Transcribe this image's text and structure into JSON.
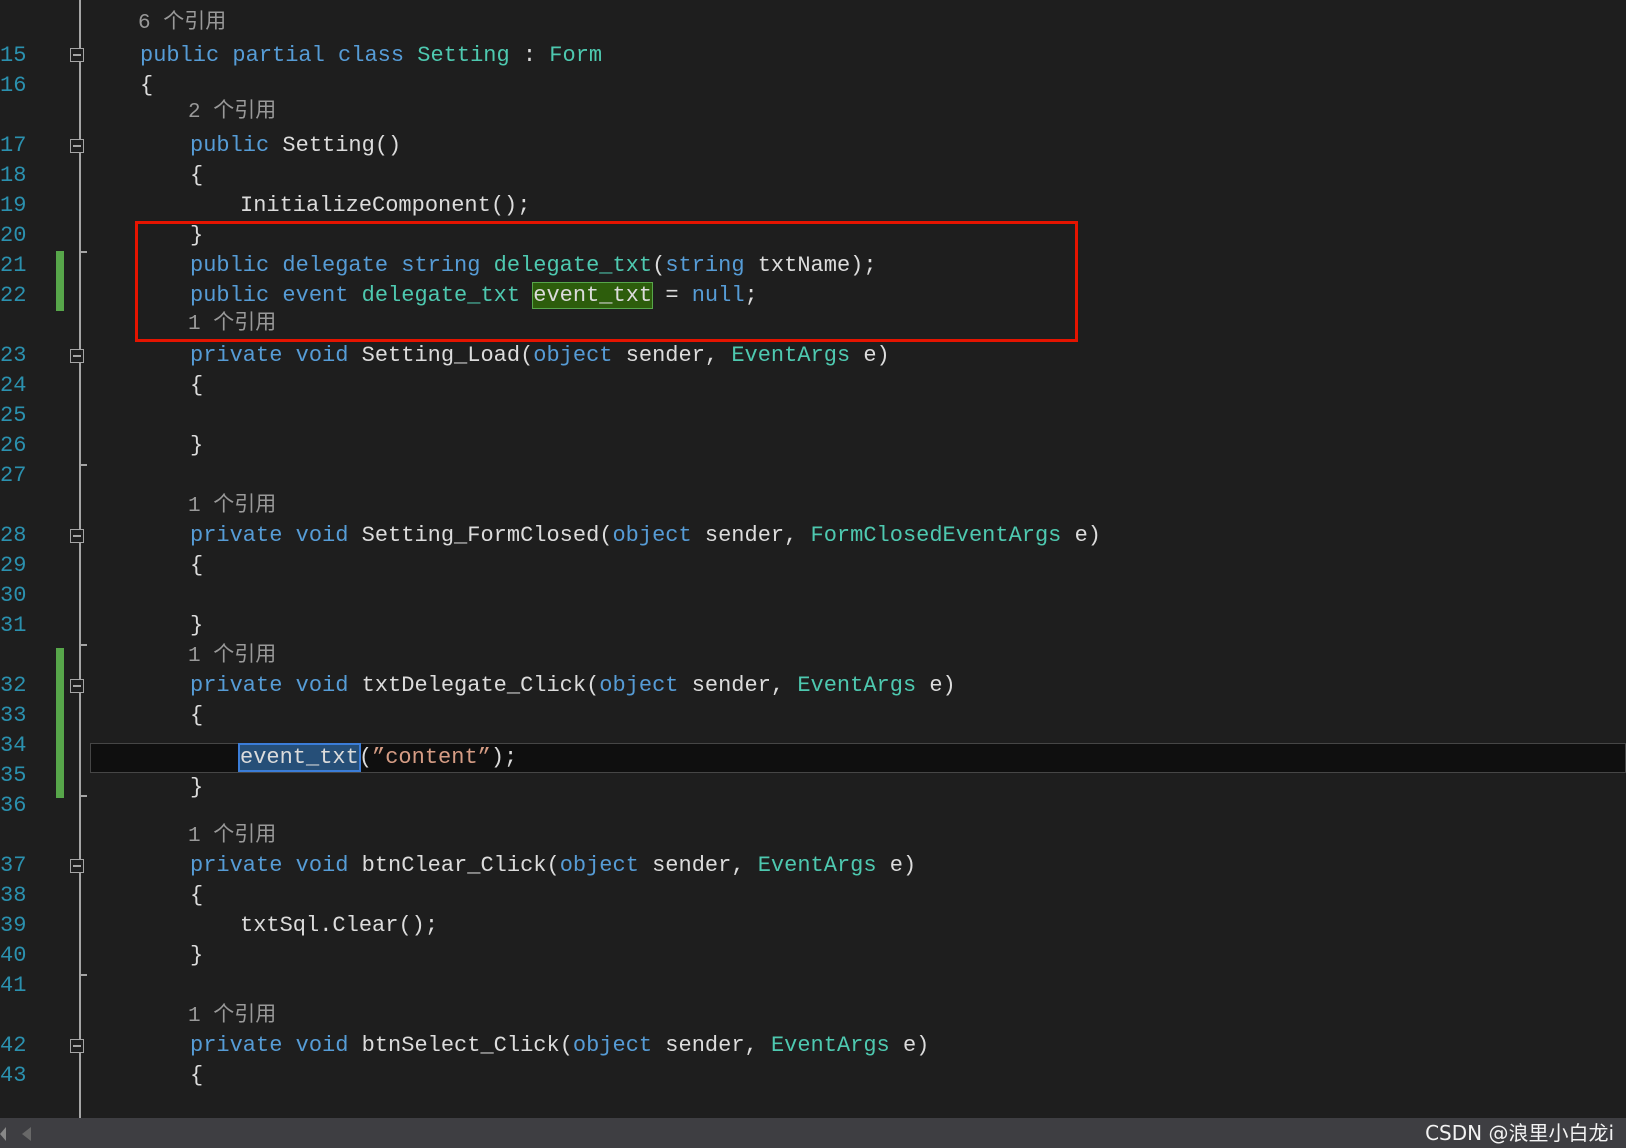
{
  "editor": {
    "ref_labels": {
      "r6": "6 个引用",
      "r2": "2 个引用",
      "r1": "1 个引用"
    },
    "line_numbers": {
      "l15": "15",
      "l16": "16",
      "l17": "17",
      "l18": "18",
      "l19": "19",
      "l20": "20",
      "l21": "21",
      "l22": "22",
      "l23": "23",
      "l24": "24",
      "l25": "25",
      "l26": "26",
      "l27": "27",
      "l28": "28",
      "l29": "29",
      "l30": "30",
      "l31": "31",
      "l32": "32",
      "l33": "33",
      "l34": "34",
      "l35": "35",
      "l36": "36",
      "l37": "37",
      "l38": "38",
      "l39": "39",
      "l40": "40",
      "l41": "41",
      "l42": "42",
      "l43": "43"
    },
    "tokens": {
      "public": "public",
      "partial": "partial",
      "class": "class",
      "Setting": "Setting",
      "colon": ":",
      "Form": "Form",
      "open_brace": "{",
      "close_brace": "}",
      "paren_pair": "()",
      "InitializeComponent": "InitializeComponent",
      "call_end": "();",
      "delegate": "delegate",
      "string": "string",
      "delegate_txt": "delegate_txt",
      "open_paren": "(",
      "txtName_end": " txtName);",
      "event": "event",
      "event_txt": "event_txt",
      "eq": "=",
      "null": "null",
      "semicolon": ";",
      "private": "private",
      "void": "void",
      "Setting_Load": "Setting_Load",
      "object": "object",
      "sender_comma": " sender,",
      "EventArgs": "EventArgs",
      "e_close": " e)",
      "Setting_FormClosed": "Setting_FormClosed",
      "FormClosedEventArgs": "FormClosedEventArgs",
      "txtDelegate_Click": "txtDelegate_Click",
      "content_arg": "”content”",
      "close_call": ");",
      "btnClear_Click": "btnClear_Click",
      "txtSql_Clear": "txtSql.Clear",
      "btnSelect_Click": "btnSelect_Click"
    }
  },
  "colors": {
    "keyword": "#569cd6",
    "type": "#4ec9b0",
    "string": "#d69d85",
    "line_number": "#2b91af",
    "highlight_box": "#e51400"
  },
  "watermark": "CSDN @浪里小白龙i"
}
